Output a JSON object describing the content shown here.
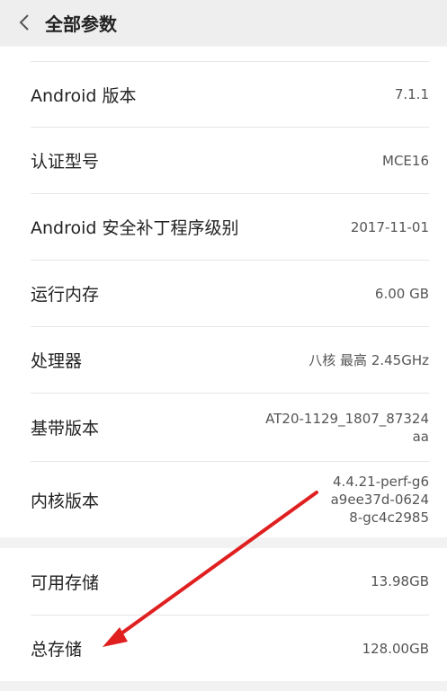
{
  "header": {
    "title": "全部参数",
    "back_icon": "back-chevron-icon"
  },
  "rows": [
    {
      "label": "Android 版本",
      "value": "7.1.1"
    },
    {
      "label": "认证型号",
      "value": "MCE16"
    },
    {
      "label": "Android 安全补丁程序级别",
      "value": "2017-11-01"
    },
    {
      "label": "运行内存",
      "value": "6.00 GB"
    },
    {
      "label": "处理器",
      "value": "八核 最高 2.45GHz"
    },
    {
      "label": "基带版本",
      "value": "AT20-1129_1807_87324aa"
    },
    {
      "label": "内核版本",
      "value": "4.4.21-perf-g6a9ee37d-06248-gc4c2985"
    }
  ],
  "storage_rows": [
    {
      "label": "可用存储",
      "value": "13.98GB"
    },
    {
      "label": "总存储",
      "value": "128.00GB"
    }
  ],
  "annotation": {
    "arrow_color": "#e02020"
  }
}
